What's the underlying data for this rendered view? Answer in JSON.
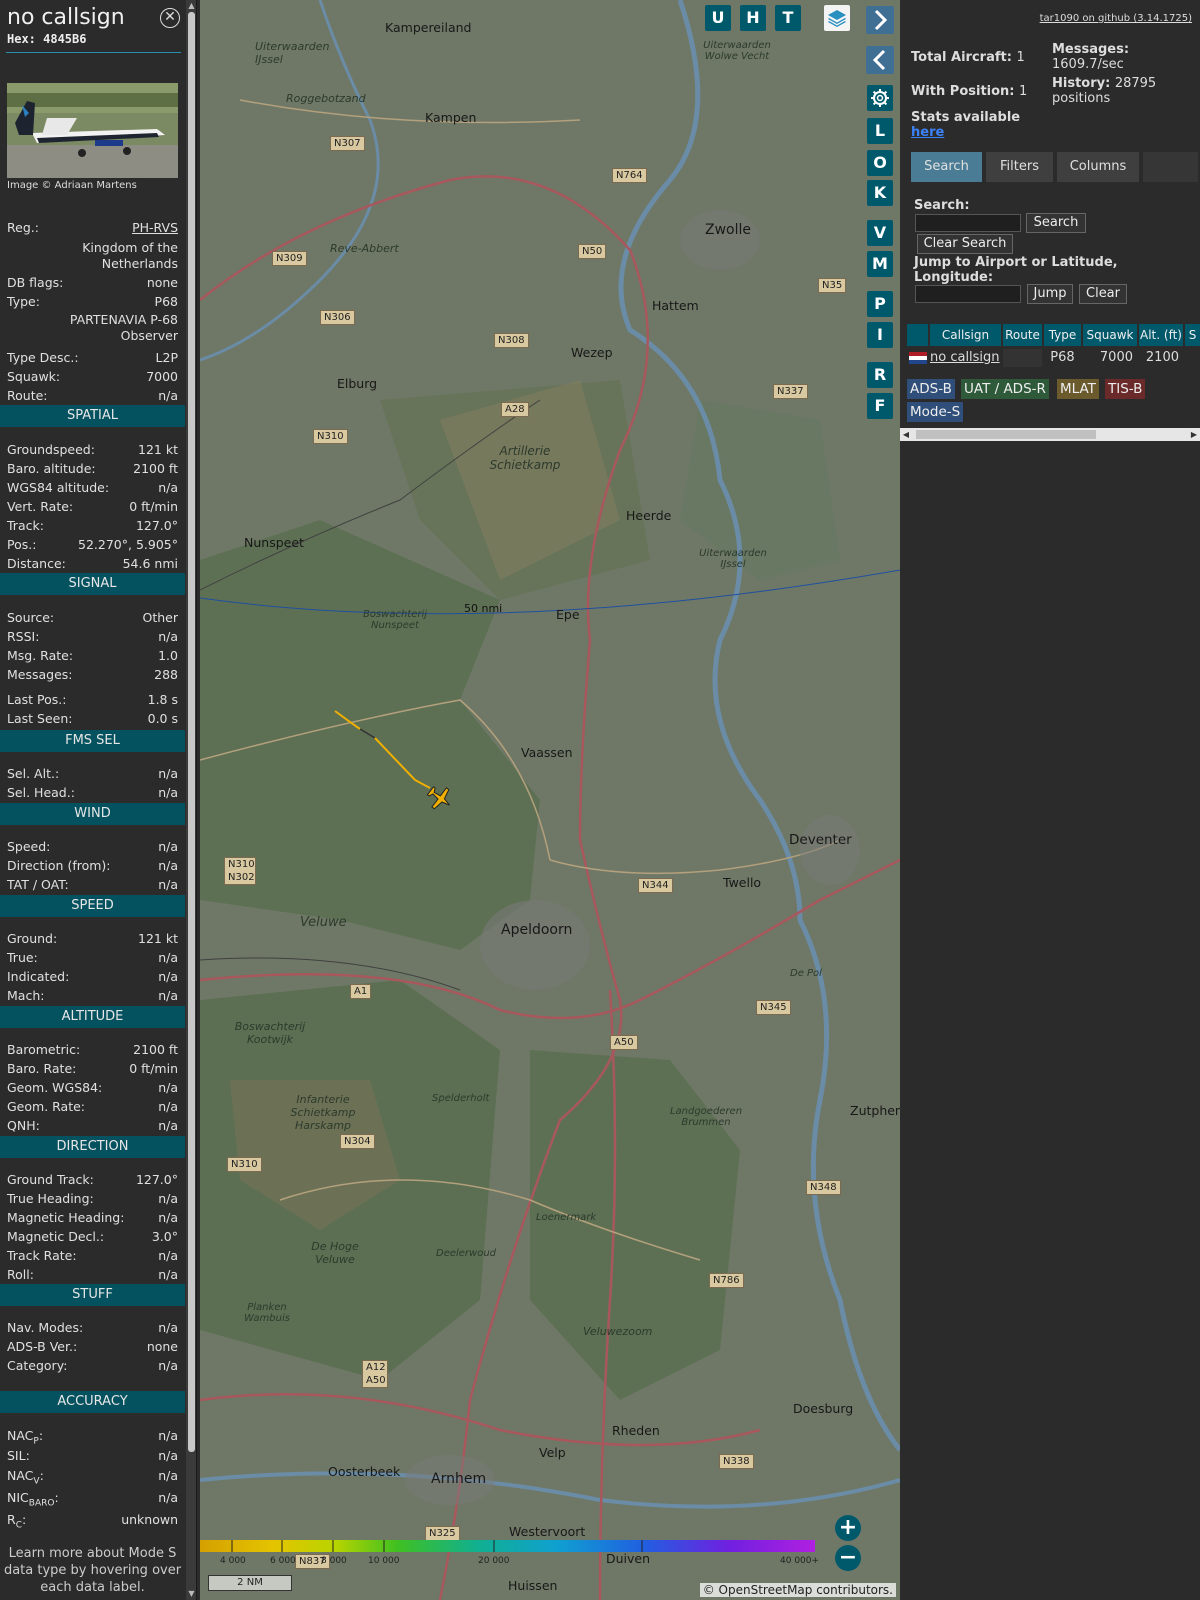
{
  "info": {
    "callsign": "no callsign",
    "hex": "Hex: 4845B6",
    "close_icon": "close-circle-icon",
    "photo_credit": "Image © Adriaan Martens",
    "rows_top": [
      {
        "k": "Reg.:",
        "v": "PH-RVS",
        "link": true
      },
      {
        "k": "",
        "v": "Kingdom of the Netherlands"
      },
      {
        "k": "DB flags:",
        "v": "none"
      },
      {
        "k": "Type:",
        "v": "P68"
      },
      {
        "k": "",
        "v": "PARTENAVIA P-68 Observer"
      },
      {
        "k": "Type Desc.:",
        "v": "L2P"
      },
      {
        "k": "Squawk:",
        "v": "7000"
      },
      {
        "k": "Route:",
        "v": "n/a"
      }
    ],
    "spatial": {
      "title": "SPATIAL",
      "rows": [
        {
          "k": "Groundspeed:",
          "v": "121 kt"
        },
        {
          "k": "Baro. altitude:",
          "v": "2100 ft"
        },
        {
          "k": "WGS84 altitude:",
          "v": "n/a"
        },
        {
          "k": "Vert. Rate:",
          "v": "0 ft/min"
        },
        {
          "k": "Track:",
          "v": "127.0°"
        },
        {
          "k": "Pos.:",
          "v": "52.270°, 5.905°"
        },
        {
          "k": "Distance:",
          "v": "54.6 nmi"
        }
      ]
    },
    "signal": {
      "title": "SIGNAL",
      "rows": [
        {
          "k": "Source:",
          "v": "Other"
        },
        {
          "k": "RSSI:",
          "v": "n/a"
        },
        {
          "k": "Msg. Rate:",
          "v": "1.0"
        },
        {
          "k": "Messages:",
          "v": "288"
        },
        {
          "k": "Last Pos.:",
          "v": "1.8 s"
        },
        {
          "k": "Last Seen:",
          "v": "0.0 s"
        }
      ]
    },
    "fms": {
      "title": "FMS SEL",
      "rows": [
        {
          "k": "Sel. Alt.:",
          "v": "n/a"
        },
        {
          "k": "Sel. Head.:",
          "v": "n/a"
        }
      ]
    },
    "wind": {
      "title": "WIND",
      "rows": [
        {
          "k": "Speed:",
          "v": "n/a"
        },
        {
          "k": "Direction (from):",
          "v": "n/a"
        },
        {
          "k": "TAT / OAT:",
          "v": "n/a"
        }
      ]
    },
    "speed": {
      "title": "SPEED",
      "rows": [
        {
          "k": "Ground:",
          "v": "121 kt"
        },
        {
          "k": "True:",
          "v": "n/a"
        },
        {
          "k": "Indicated:",
          "v": "n/a"
        },
        {
          "k": "Mach:",
          "v": "n/a"
        }
      ]
    },
    "altitude": {
      "title": "ALTITUDE",
      "rows": [
        {
          "k": "Barometric:",
          "v": "2100 ft"
        },
        {
          "k": "Baro. Rate:",
          "v": "0 ft/min"
        },
        {
          "k": "Geom. WGS84:",
          "v": "n/a"
        },
        {
          "k": "Geom. Rate:",
          "v": "n/a"
        },
        {
          "k": "QNH:",
          "v": "n/a"
        }
      ]
    },
    "direction": {
      "title": "DIRECTION",
      "rows": [
        {
          "k": "Ground Track:",
          "v": "127.0°"
        },
        {
          "k": "True Heading:",
          "v": "n/a"
        },
        {
          "k": "Magnetic Heading:",
          "v": "n/a"
        },
        {
          "k": "Magnetic Decl.:",
          "v": "3.0°"
        },
        {
          "k": "Track Rate:",
          "v": "n/a"
        },
        {
          "k": "Roll:",
          "v": "n/a"
        }
      ]
    },
    "stuff": {
      "title": "STUFF",
      "rows": [
        {
          "k": "Nav. Modes:",
          "v": "n/a"
        },
        {
          "k": "ADS-B Ver.:",
          "v": "none"
        },
        {
          "k": "Category:",
          "v": "n/a"
        }
      ]
    },
    "accuracy": {
      "title": "ACCURACY",
      "rows": [
        {
          "k": "NAC",
          "sub": "P",
          "v": "n/a"
        },
        {
          "k": "SIL:",
          "sub": "",
          "v": "n/a"
        },
        {
          "k": "NAC",
          "sub": "V",
          "v": "n/a"
        },
        {
          "k": "NIC",
          "sub": "BARO",
          "v": "n/a"
        },
        {
          "k": "R",
          "sub": "C",
          "v": "unknown"
        }
      ]
    },
    "learn_more": "Learn more about Mode S data type by hovering over each data label."
  },
  "map": {
    "buttons": [
      "U",
      "H",
      "T"
    ],
    "side_buttons": [
      "L",
      "O",
      "K",
      "V",
      "M",
      "P",
      "I",
      "R",
      "F"
    ],
    "layers_icon": "layers-icon",
    "settings_icon": "gear-icon",
    "range_label": "50 nmi",
    "scale_label": "2 NM",
    "attribution": "© OpenStreetMap contributors.",
    "altitude_scale": [
      "4 000",
      "6 000",
      "8 000",
      "10 000",
      "20 000",
      "40 000+"
    ],
    "altitude_colors": [
      "#d4a000",
      "#e4c400",
      "#b8d400",
      "#40c020",
      "#10b090",
      "#10a0d0",
      "#2060e0",
      "#7020e0",
      "#b020e0"
    ],
    "places": [
      "Kampereiland",
      "Kampen",
      "Zwolle",
      "Hattem",
      "Wezep",
      "Elburg",
      "Heerde",
      "Nunspeet",
      "Epe",
      "Vaassen",
      "Deventer",
      "Twello",
      "Apeldoorn",
      "Zutphen",
      "Doesburg",
      "Rheden",
      "Velp",
      "Arnhem",
      "Oosterbeek",
      "Westervoort",
      "Huissen",
      "Duiven"
    ],
    "regions": [
      "Uiterwaarden IJssel",
      "Roggebotzand",
      "Reve-Abbert",
      "Artillerie Schietkamp",
      "Boswachterij Nunspeet",
      "Uiterwaarden IJssel",
      "Veluwe",
      "Boswachterij Kootwijk",
      "Infanterie Schietkamp Harskamp",
      "Spelderholt",
      "Landgoederen Brummen",
      "Loenermark",
      "De Hoge Veluwe",
      "Deelerwoud",
      "Planken Wambuis",
      "Veluwezoom",
      "De Pol",
      "Uiterwaarden Wolwe Vecht"
    ],
    "roads": [
      "N307",
      "N764",
      "N50",
      "N35",
      "N309",
      "N306",
      "N308",
      "N337",
      "A28",
      "N310",
      "N344",
      "N310 N302",
      "N345",
      "A1",
      "A50",
      "N304",
      "N310",
      "N348",
      "N786",
      "A12 A50",
      "N338",
      "N325",
      "N837"
    ]
  },
  "side": {
    "github_link": "tar1090 on github (3.14.1725)",
    "total_aircraft_label": "Total Aircraft:",
    "total_aircraft": "1",
    "with_position_label": "With Position:",
    "with_position": "1",
    "messages_label": "Messages:",
    "messages_rate": "1609.7/sec",
    "history_label": "History:",
    "history_value": "28795 positions",
    "stats_label": "Stats available",
    "stats_link": "here",
    "tabs": [
      "Search",
      "Filters",
      "Columns"
    ],
    "search_label": "Search:",
    "search_button": "Search",
    "clear_search_button": "Clear Search",
    "jump_label": "Jump to Airport or Latitude, Longitude:",
    "jump_button": "Jump",
    "clear_button": "Clear",
    "table_headers": [
      "Callsign",
      "Route",
      "Type",
      "Squawk",
      "Alt. (ft)",
      "S"
    ],
    "table_row": {
      "callsign": "no callsign",
      "route": "",
      "type": "P68",
      "squawk": "7000",
      "alt": "2100"
    },
    "sources": [
      {
        "label": "ADS-B",
        "color": "#2f4f7a"
      },
      {
        "label": "UAT / ADS-R",
        "color": "#2f5a3a"
      },
      {
        "label": "MLAT",
        "color": "#6b5a2c"
      },
      {
        "label": "TIS-B",
        "color": "#6a2a2a"
      },
      {
        "label": "Mode-S",
        "color": "#2f4f7a"
      }
    ]
  }
}
